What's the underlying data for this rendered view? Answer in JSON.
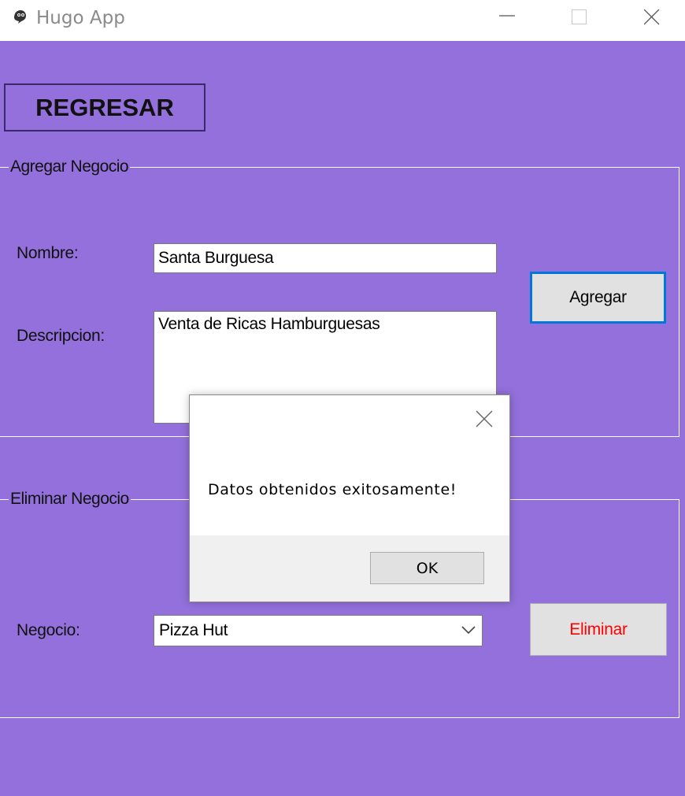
{
  "window": {
    "title": "Hugo App",
    "icon": "ghost-app-icon",
    "controls": [
      "minimize-icon",
      "maximize-icon",
      "close-icon"
    ]
  },
  "main": {
    "back_button_label": "REGRESAR",
    "add_group": {
      "legend": "Agregar Negocio",
      "nombre_label": "Nombre:",
      "nombre_value": "Santa Burguesa",
      "descripcion_label": "Descripcion:",
      "descripcion_value": "Venta de Ricas Hamburguesas",
      "add_button_label": "Agregar"
    },
    "delete_group": {
      "legend": "Eliminar Negocio",
      "negocio_label": "Negocio:",
      "negocio_selected": "Pizza Hut",
      "delete_button_label": "Eliminar"
    }
  },
  "dialog": {
    "message": "Datos obtenidos exitosamente!",
    "ok_label": "OK"
  },
  "colors": {
    "background": "#9370DB",
    "delete_text": "#FF0000",
    "focus_border": "#0078D7"
  }
}
